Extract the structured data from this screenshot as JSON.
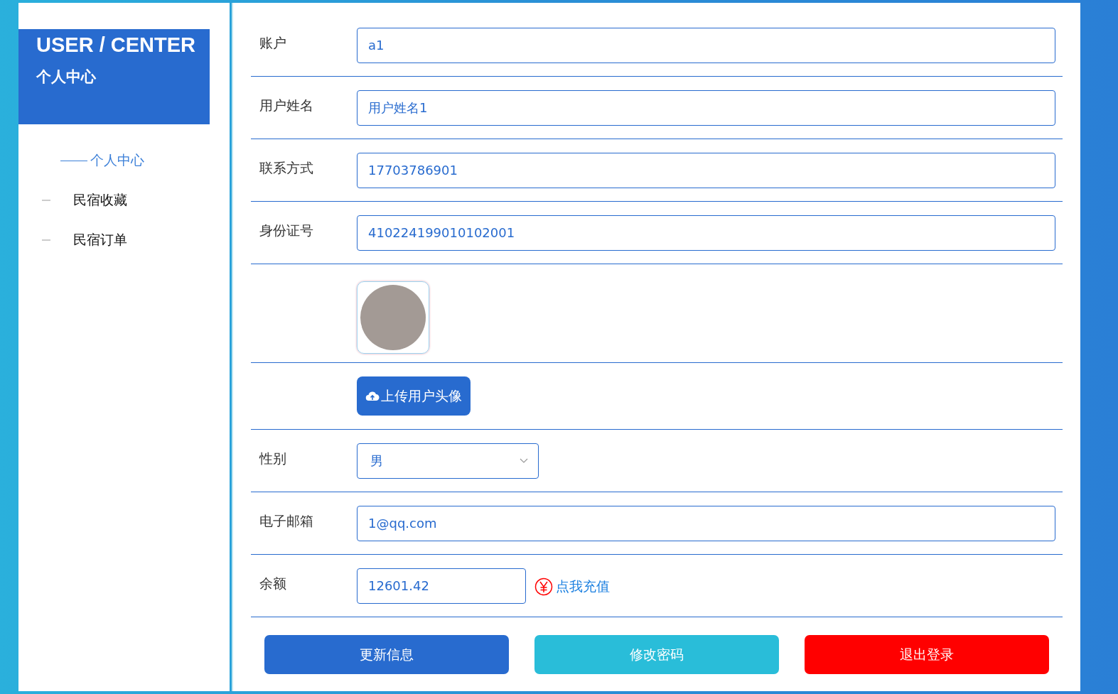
{
  "sidebar": {
    "title": "USER / CENTER",
    "subtitle": "个人中心",
    "items": [
      {
        "label": "个人中心",
        "selected": true
      },
      {
        "label": "民宿收藏",
        "selected": false
      },
      {
        "label": "民宿订单",
        "selected": false
      }
    ]
  },
  "form": {
    "rows": [
      {
        "kind": "text",
        "label": "账户",
        "value": "a1"
      },
      {
        "kind": "text",
        "label": "用户姓名",
        "value": "用户姓名1"
      },
      {
        "kind": "text",
        "label": "联系方式",
        "value": "17703786901"
      },
      {
        "kind": "text",
        "label": "身份证号",
        "value": "410224199010102001"
      },
      {
        "kind": "avatar"
      },
      {
        "kind": "upload",
        "button": "上传用户头像"
      },
      {
        "kind": "select",
        "label": "性别",
        "value": "男"
      },
      {
        "kind": "text",
        "label": "电子邮箱",
        "value": "1@qq.com"
      },
      {
        "kind": "balance",
        "label": "余额",
        "value": "12601.42",
        "link": "点我充值"
      }
    ]
  },
  "buttons": [
    {
      "label": "更新信息",
      "color": "#286bcf"
    },
    {
      "label": "修改密码",
      "color": "#29bdd9"
    },
    {
      "label": "退出登录",
      "color": "#ff0000"
    }
  ]
}
